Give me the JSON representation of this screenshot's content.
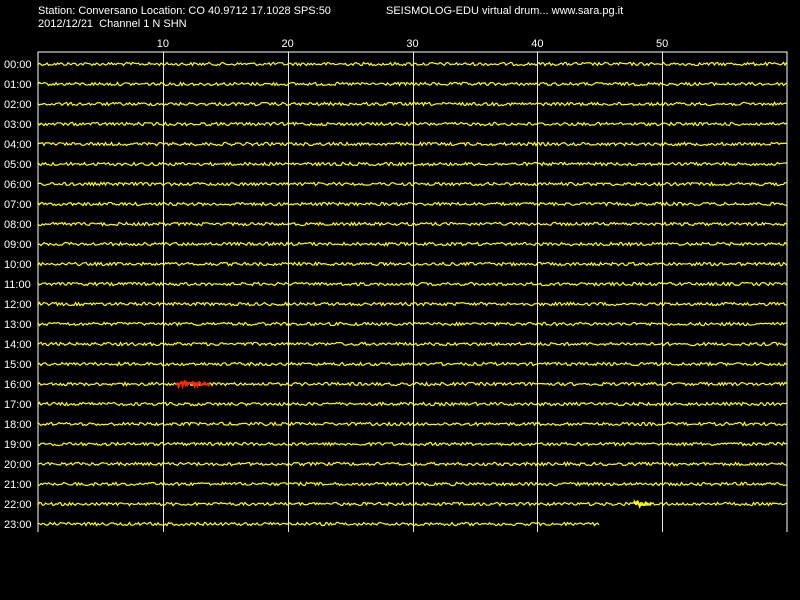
{
  "header": {
    "station_line": "Station: Conversano Location: CO 40.9712 17.1028 SPS:50",
    "app_line": "SEISMOLOG-EDU virtual drum... www.sara.pg.it",
    "date_line": "2012/12/21  Channel 1 N SHN"
  },
  "colors": {
    "background": "#000000",
    "trace": "#ffff00",
    "event": "#ff2a00",
    "grid": "#ffffff",
    "text": "#ffffff"
  },
  "chart_data": {
    "type": "line",
    "title": "",
    "xlabel": "",
    "ylabel": "",
    "x_unit": "minutes",
    "xlim": [
      0,
      60
    ],
    "x_ticks": [
      10,
      20,
      30,
      40,
      50
    ],
    "x_tick_labels": [
      "10",
      "20",
      "30",
      "40",
      "50"
    ],
    "grid": true,
    "rows": [
      {
        "label": "00:00",
        "end_minute": 60
      },
      {
        "label": "01:00",
        "end_minute": 60
      },
      {
        "label": "02:00",
        "end_minute": 60
      },
      {
        "label": "03:00",
        "end_minute": 60
      },
      {
        "label": "04:00",
        "end_minute": 60
      },
      {
        "label": "05:00",
        "end_minute": 60
      },
      {
        "label": "06:00",
        "end_minute": 60
      },
      {
        "label": "07:00",
        "end_minute": 60
      },
      {
        "label": "08:00",
        "end_minute": 60
      },
      {
        "label": "09:00",
        "end_minute": 60
      },
      {
        "label": "10:00",
        "end_minute": 60
      },
      {
        "label": "11:00",
        "end_minute": 60
      },
      {
        "label": "12:00",
        "end_minute": 60
      },
      {
        "label": "13:00",
        "end_minute": 60
      },
      {
        "label": "14:00",
        "end_minute": 60
      },
      {
        "label": "15:00",
        "end_minute": 60
      },
      {
        "label": "16:00",
        "end_minute": 60
      },
      {
        "label": "17:00",
        "end_minute": 60
      },
      {
        "label": "18:00",
        "end_minute": 60
      },
      {
        "label": "19:00",
        "end_minute": 60
      },
      {
        "label": "20:00",
        "end_minute": 60
      },
      {
        "label": "21:00",
        "end_minute": 60
      },
      {
        "label": "22:00",
        "end_minute": 60
      },
      {
        "label": "23:00",
        "end_minute": 45
      }
    ],
    "events": [
      {
        "row": "16:00",
        "start_minute": 11.1,
        "end_minute": 13.8,
        "color": "#ff2a00"
      },
      {
        "row": "22:00",
        "start_minute": 47.8,
        "end_minute": 49.2,
        "color": "#ffff00"
      }
    ]
  }
}
